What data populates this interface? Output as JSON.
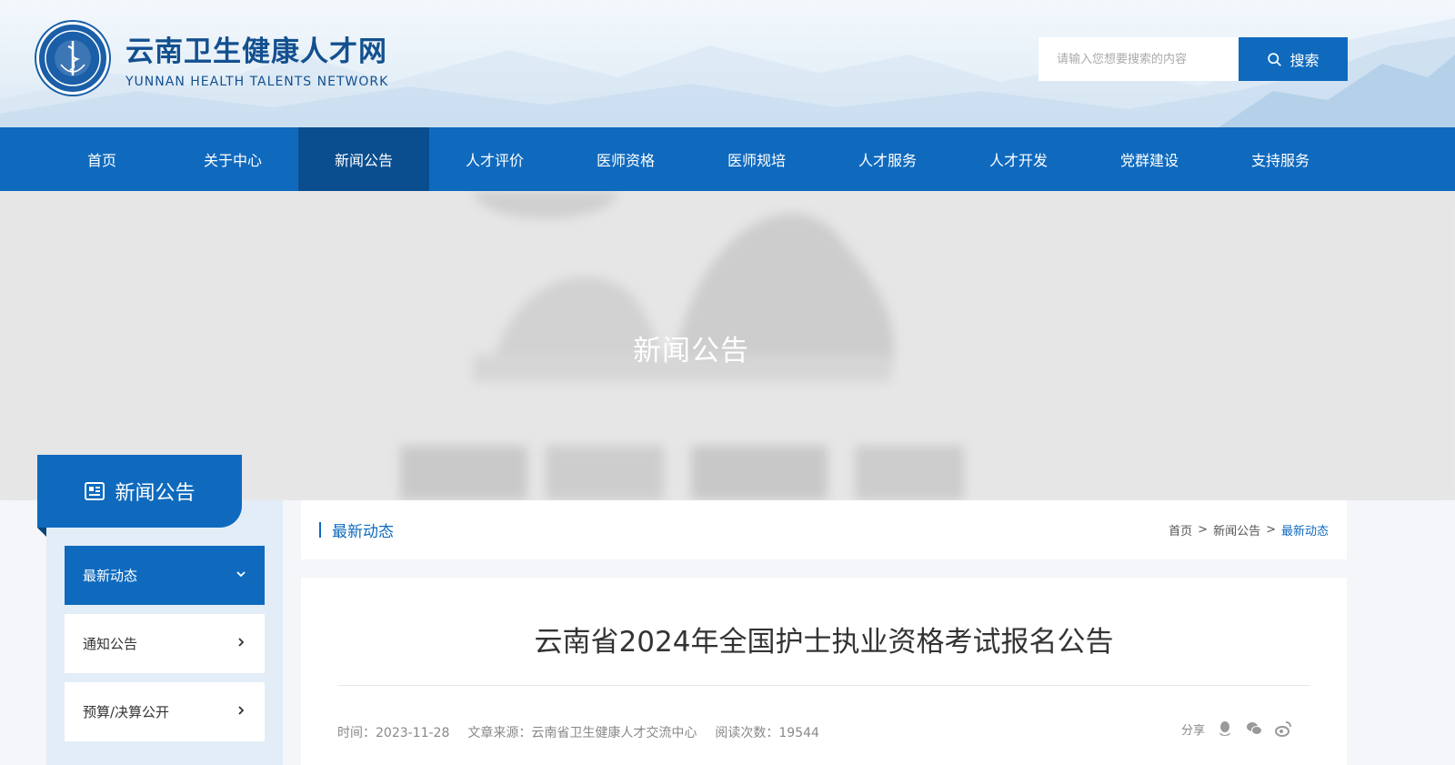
{
  "header": {
    "site_name_cn": "云南卫生健康人才网",
    "site_name_en": "YUNNAN HEALTH TALENTS NETWORK",
    "logo_icon": "organization-seal-icon"
  },
  "search": {
    "placeholder": "请输入您想要搜索的内容",
    "button_label": "搜索",
    "icon": "search-icon"
  },
  "nav": {
    "items": [
      {
        "label": "首页"
      },
      {
        "label": "关于中心"
      },
      {
        "label": "新闻公告",
        "active": true
      },
      {
        "label": "人才评价"
      },
      {
        "label": "医师资格"
      },
      {
        "label": "医师规培"
      },
      {
        "label": "人才服务"
      },
      {
        "label": "人才开发"
      },
      {
        "label": "党群建设"
      },
      {
        "label": "支持服务"
      }
    ]
  },
  "banner": {
    "title": "新闻公告"
  },
  "sidebar": {
    "heading": "新闻公告",
    "heading_icon": "news-icon",
    "items": [
      {
        "label": "最新动态",
        "active": true,
        "icon": "chevron-down-icon"
      },
      {
        "label": "通知公告",
        "icon": "chevron-right-icon"
      },
      {
        "label": "预算/决算公开",
        "icon": "chevron-right-icon"
      }
    ]
  },
  "breadcrumb": {
    "section": "最新动态",
    "trail": [
      "首页",
      "新闻公告",
      "最新动态"
    ],
    "separator": ">"
  },
  "article": {
    "title": "云南省2024年全国护士执业资格考试报名公告",
    "date": "时间：2023-11-28",
    "source": "文章来源：云南省卫生健康人才交流中心",
    "views": "阅读次数：19544",
    "share_label": "分享",
    "share_icons": [
      "qq-icon",
      "wechat-icon",
      "weibo-icon"
    ]
  },
  "colors": {
    "primary": "#0f6abe",
    "nav_active": "#0a4e8f",
    "brand_text": "#13508f"
  }
}
